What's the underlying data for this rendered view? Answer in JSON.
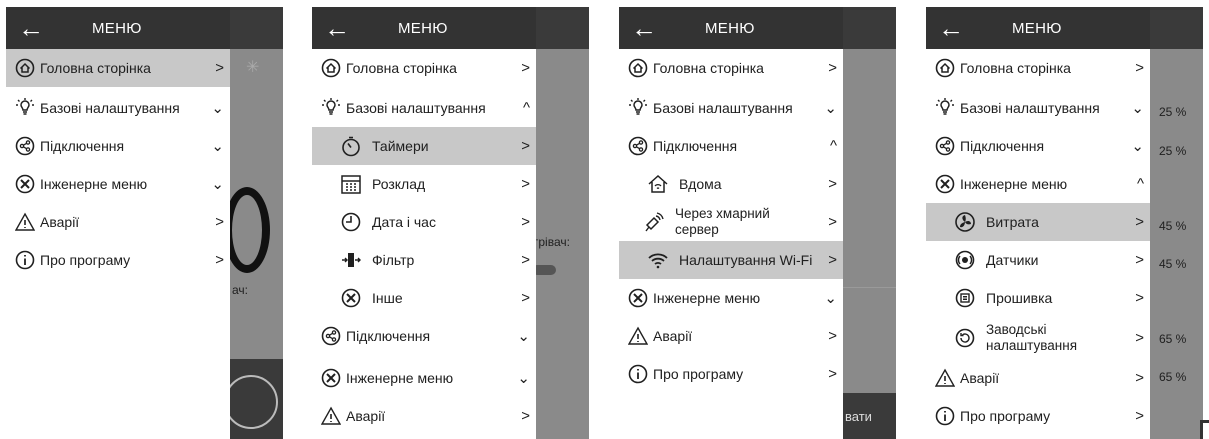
{
  "menu_title": "МЕНЮ",
  "labels": {
    "home": "Головна сторінка",
    "basic": "Базові налаштування",
    "conn": "Підключення",
    "eng": "Інженерне меню",
    "alarms": "Аварії",
    "about": "Про програму",
    "timers": "Таймери",
    "schedule": "Розклад",
    "datetime": "Дата і час",
    "filter": "Фільтр",
    "other": "Інше",
    "at_home": "Вдома",
    "cloud": "Через хмарний сервер",
    "wifi": "Налаштування Wi-Fi",
    "flow": "Витрата",
    "sensors": "Датчики",
    "firmware": "Прошивка",
    "factory": "Заводські налаштування"
  },
  "background_fragments": {
    "s1_text": "ач:",
    "s2_text": "грівач:",
    "s3_text": "вати"
  },
  "percent_values": [
    "25 %",
    "25 %",
    "45 %",
    "45 %",
    "65 %",
    "65 %"
  ],
  "colors": {
    "header": "#333333",
    "selected": "#c8c8c8",
    "overlay": "#8a8a8a"
  }
}
